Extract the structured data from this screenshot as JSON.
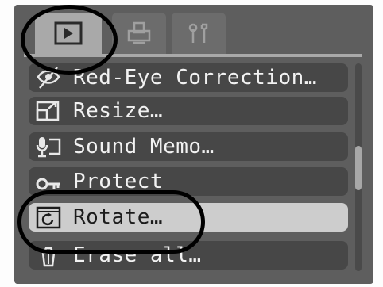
{
  "tabs": [
    {
      "name": "playback",
      "icon": "play-icon",
      "active": true
    },
    {
      "name": "print",
      "icon": "print-icon",
      "active": false
    },
    {
      "name": "setup",
      "icon": "tools-icon",
      "active": false
    }
  ],
  "menu": {
    "items": [
      {
        "label": "Red-Eye Correction…",
        "icon": "red-eye-icon"
      },
      {
        "label": "Resize…",
        "icon": "resize-icon"
      },
      {
        "label": "Sound Memo…",
        "icon": "microphone-icon"
      },
      {
        "label": "Protect",
        "icon": "key-icon"
      },
      {
        "label": "Rotate…",
        "icon": "rotate-icon",
        "selected": true
      },
      {
        "label": "Erase all…",
        "icon": "trash-icon"
      }
    ]
  },
  "colors": {
    "lcd_background": "#5e5e5e",
    "menu_item": "#474747",
    "selected_item": "#cdcdcd",
    "active_tab": "#a9a9a9"
  }
}
